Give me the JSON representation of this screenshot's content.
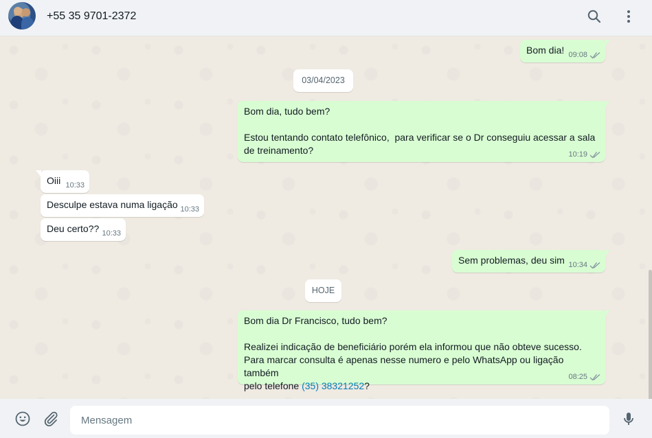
{
  "header": {
    "contact_name": "+55 35 9701-2372"
  },
  "icons": {
    "search": "search-icon",
    "menu": "menu-dots-icon",
    "emoji": "emoji-icon",
    "attach": "paperclip-icon",
    "mic": "microphone-icon",
    "read_receipt": "double-check-icon"
  },
  "colors": {
    "outgoing_bubble": "#d9fdd3",
    "incoming_bubble": "#ffffff",
    "chat_background": "#efeae2",
    "header_background": "#f0f2f5",
    "read_tick": "#8696a0",
    "link": "#027eb5"
  },
  "messages": [
    {
      "text": "Bom dia!",
      "time": "09:08"
    },
    {
      "text": "Bom dia, tudo bem?\n\nEstou tentando contato telefônico,  para verificar se o Dr conseguiu acessar a sala\nde treinamento?",
      "time": "10:19"
    },
    {
      "text": "Oiii",
      "time": "10:33"
    },
    {
      "text": "Desculpe estava numa ligação",
      "time": "10:33"
    },
    {
      "text": "Deu certo??",
      "time": "10:33"
    },
    {
      "text": "Sem problemas, deu sim",
      "time": "10:34"
    },
    {
      "text_before_link": "Bom dia Dr Francisco, tudo bem?\n\nRealizei indicação de beneficiário porém ela informou que não obteve sucesso.\nPara marcar consulta é apenas nesse numero e pelo WhatsApp ou ligação também\npelo telefone ",
      "link": "(35) 38321252",
      "text_after_link": "?",
      "time": "08:25"
    }
  ],
  "date_chips": [
    "03/04/2023",
    "HOJE"
  ],
  "composer": {
    "placeholder": "Mensagem"
  }
}
